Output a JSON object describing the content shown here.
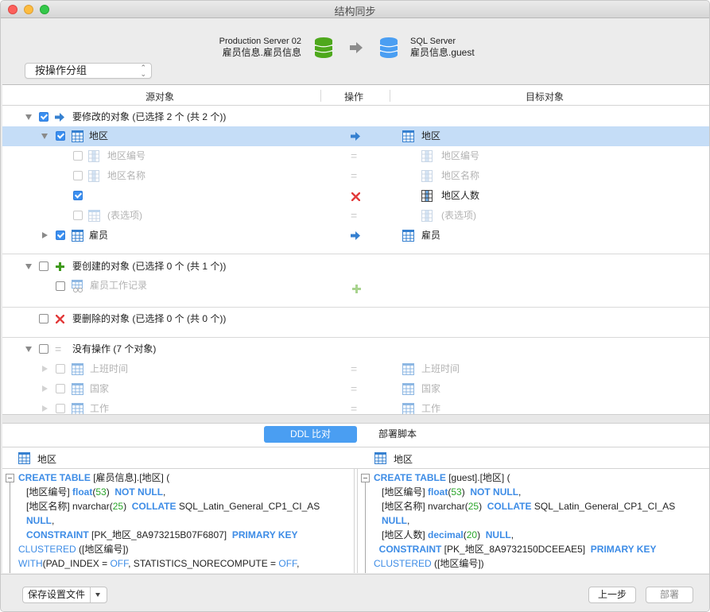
{
  "window": {
    "title": "结构同步"
  },
  "header": {
    "source": {
      "server": "Production Server 02",
      "schema": "雇员信息.雇员信息",
      "db_color": "#4ea81c"
    },
    "target": {
      "server": "SQL Server",
      "schema": "雇员信息.guest",
      "db_color": "#4a9ef2"
    },
    "group_select": {
      "value": "按操作分组"
    }
  },
  "tree": {
    "columns": {
      "source": "源对象",
      "action": "操作",
      "target": "目标对象"
    },
    "groups": [
      {
        "label": "要修改的对象 (已选择 2 个 (共 2 个))",
        "icon": "arrow-right-icon",
        "checked": true,
        "expanded": true,
        "items": [
          {
            "source": "地区",
            "target": "地区",
            "action": "modify",
            "checked": true,
            "expanded": true,
            "selected": true,
            "children": [
              {
                "source": "地区编号",
                "target": "地区编号",
                "action": "same",
                "checked": false
              },
              {
                "source": "地区名称",
                "target": "地区名称",
                "action": "same",
                "checked": false
              },
              {
                "source": "",
                "target": "地区人数",
                "action": "delete",
                "checked": true
              },
              {
                "source": "(表选项)",
                "target": "(表选项)",
                "action": "same",
                "checked": false
              }
            ]
          },
          {
            "source": "雇员",
            "target": "雇员",
            "action": "modify",
            "checked": true,
            "expanded": false
          }
        ]
      },
      {
        "label": "要创建的对象 (已选择 0 个 (共 1 个))",
        "icon": "plus-icon",
        "checked": false,
        "expanded": true,
        "items": [
          {
            "source": "雇员工作记录",
            "target": "",
            "action": "create",
            "checked": false
          }
        ]
      },
      {
        "label": "要删除的对象 (已选择 0 个 (共 0 个))",
        "icon": "x-icon",
        "checked": false,
        "items": []
      },
      {
        "label": "没有操作 (7 个对象)",
        "icon": "equals-icon",
        "checked": false,
        "expanded": true,
        "items": [
          {
            "source": "上班时间",
            "target": "上班时间",
            "action": "same",
            "checked": false
          },
          {
            "source": "国家",
            "target": "国家",
            "action": "same",
            "checked": false
          },
          {
            "source": "工作",
            "target": "工作",
            "action": "same",
            "checked": false
          }
        ]
      }
    ]
  },
  "ddl": {
    "tabs": {
      "compare": "DDL 比对",
      "script": "部署脚本"
    },
    "left_title": "地区",
    "right_title": "地区",
    "left_lines": [
      [
        [
          "kw",
          "CREATE TABLE"
        ],
        [
          "t",
          " [雇员信息].[地区] ("
        ]
      ],
      [
        [
          "t",
          "   [地区编号] "
        ],
        [
          "kw",
          "float"
        ],
        [
          "t",
          "("
        ],
        [
          "num",
          "53"
        ],
        [
          "t",
          ")  "
        ],
        [
          "kw",
          "NOT NULL"
        ],
        [
          "t",
          ","
        ]
      ],
      [
        [
          "t",
          "   [地区名称] nvarchar("
        ],
        [
          "num",
          "25"
        ],
        [
          "t",
          ")  "
        ],
        [
          "kw",
          "COLLATE"
        ],
        [
          "t",
          " SQL_Latin_General_CP1_CI_AS"
        ]
      ],
      [
        [
          "t",
          "   "
        ],
        [
          "kw",
          "NULL"
        ],
        [
          "t",
          ","
        ]
      ],
      [
        [
          "t",
          "   "
        ],
        [
          "kw",
          "CONSTRAINT"
        ],
        [
          "t",
          " [PK_地区_8A973215B07F6807]  "
        ],
        [
          "kw",
          "PRIMARY KEY"
        ]
      ],
      [
        [
          "kw2",
          "CLUSTERED"
        ],
        [
          "t",
          " ([地区编号])"
        ]
      ],
      [
        [
          "kw2",
          "WITH"
        ],
        [
          "t",
          "(PAD_INDEX = "
        ],
        [
          "kw2",
          "OFF"
        ],
        [
          "t",
          ", STATISTICS_NORECOMPUTE = "
        ],
        [
          "kw2",
          "OFF"
        ],
        [
          "t",
          ","
        ]
      ]
    ],
    "right_lines": [
      [
        [
          "kw",
          "CREATE TABLE"
        ],
        [
          "t",
          " [guest].[地区] ("
        ]
      ],
      [
        [
          "t",
          "   [地区编号] "
        ],
        [
          "kw",
          "float"
        ],
        [
          "t",
          "("
        ],
        [
          "num",
          "53"
        ],
        [
          "t",
          ")  "
        ],
        [
          "kw",
          "NOT NULL"
        ],
        [
          "t",
          ","
        ]
      ],
      [
        [
          "t",
          "   [地区名称] nvarchar("
        ],
        [
          "num",
          "25"
        ],
        [
          "t",
          ")  "
        ],
        [
          "kw",
          "COLLATE"
        ],
        [
          "t",
          " SQL_Latin_General_CP1_CI_AS"
        ]
      ],
      [
        [
          "t",
          "   "
        ],
        [
          "kw",
          "NULL"
        ],
        [
          "t",
          ","
        ]
      ],
      [
        [
          "t",
          "   [地区人数] "
        ],
        [
          "kw",
          "decimal"
        ],
        [
          "t",
          "("
        ],
        [
          "num",
          "20"
        ],
        [
          "t",
          ")  "
        ],
        [
          "kw",
          "NULL"
        ],
        [
          "t",
          ","
        ]
      ],
      [
        [
          "t",
          "  "
        ],
        [
          "kw",
          "CONSTRAINT"
        ],
        [
          "t",
          " [PK_地区_8A9732150DCEEAE5]  "
        ],
        [
          "kw",
          "PRIMARY KEY"
        ]
      ],
      [
        [
          "kw2",
          "CLUSTERED"
        ],
        [
          "t",
          " ([地区编号])"
        ]
      ]
    ]
  },
  "footer": {
    "save_settings": "保存设置文件",
    "prev": "上一步",
    "deploy": "部署"
  }
}
